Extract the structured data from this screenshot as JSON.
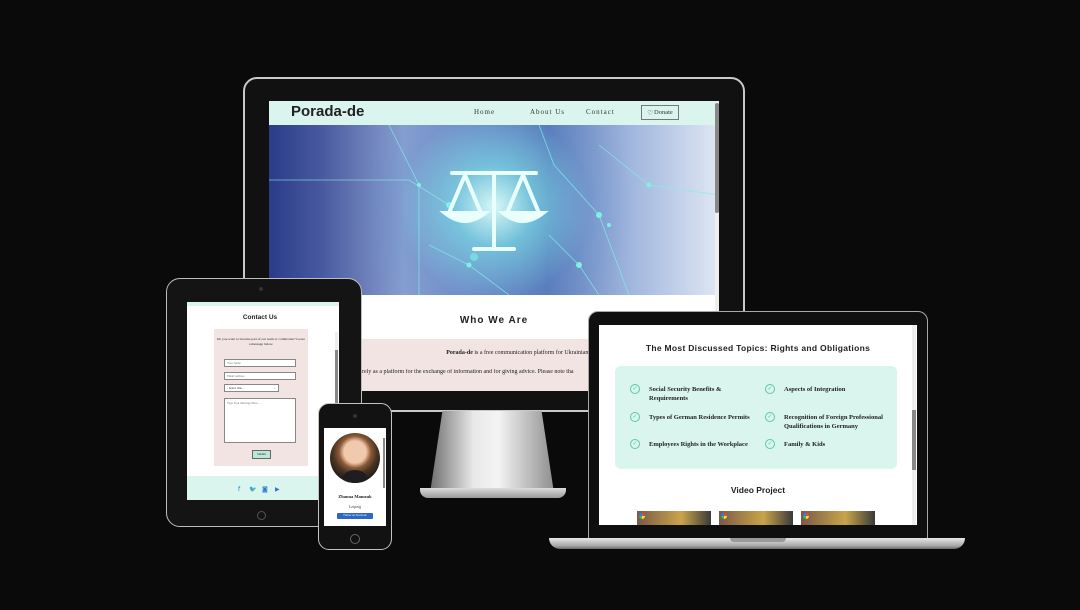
{
  "desktop": {
    "brand": "Porada-de",
    "nav": {
      "home": "Home",
      "about": "About Us",
      "contact": "Contact",
      "donate": "Donate"
    },
    "heading": "Who We Are",
    "para1_brand": "Porada-de",
    "para1_rest": " is a free communication platform for Ukrainians in Germany.",
    "para2": "urely as a platform for the exchange of information and for giving advice. Please note tha"
  },
  "tablet": {
    "title": "Contact Us",
    "question": "Do you want to become part of our team or collaborate? Leave a message below.",
    "name_placeholder": "Your Name",
    "email_placeholder": "Email Address",
    "select_value": "- Select One -",
    "message_placeholder": "Type Your Message Here...",
    "submit": "Submit"
  },
  "laptop": {
    "title": "The Most Discussed Topics: Rights and Obligations",
    "topics": [
      "Social Security Benefits & Requirements",
      "Types of German Residence Permits",
      "Employees Rights in the Workplace",
      "Aspects of Integration",
      "Recognition of Foreign Professional Qualifications in Germany",
      "Family & Kids"
    ],
    "video_title": "Video Project"
  },
  "phone": {
    "name": "Zhanna Mamzuk",
    "city": "Leipzig",
    "follow": "Follow on Facebook"
  },
  "colors": {
    "mint": "#d9f5ee",
    "pink": "#f1e4e2",
    "check": "#5cc9a7",
    "facebook": "#2f66c9"
  }
}
